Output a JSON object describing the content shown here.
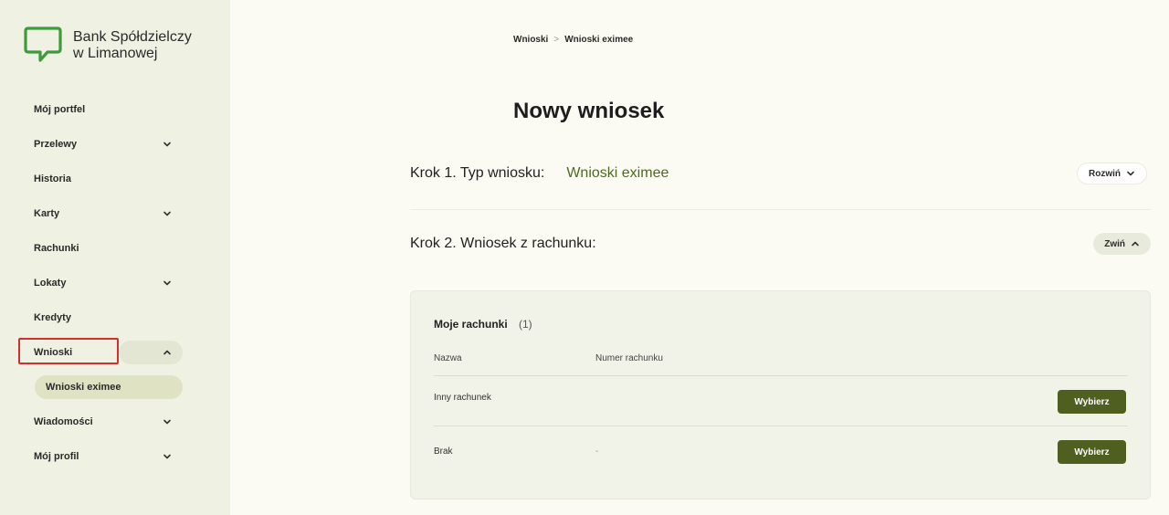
{
  "brand": {
    "line1": "Bank Spółdzielczy",
    "line2": "w Limanowej",
    "accent": "#3f9a3b"
  },
  "sidebar": {
    "items": [
      {
        "label": "Mój portfel"
      },
      {
        "label": "Przelewy"
      },
      {
        "label": "Historia"
      },
      {
        "label": "Karty"
      },
      {
        "label": "Rachunki"
      },
      {
        "label": "Lokaty"
      },
      {
        "label": "Kredyty"
      },
      {
        "label": "Wnioski"
      },
      {
        "label": "Wiadomości"
      },
      {
        "label": "Mój profil"
      }
    ],
    "sub_item": "Wnioski eximee"
  },
  "breadcrumb": {
    "items": [
      "Wnioski",
      "Wnioski eximee"
    ],
    "separator": ">"
  },
  "page": {
    "title": "Nowy wniosek"
  },
  "steps": [
    {
      "label": "Krok 1. Typ wniosku:",
      "value": "Wnioski eximee",
      "button": "Rozwiń"
    },
    {
      "label": "Krok 2. Wniosek z rachunku:",
      "value": "",
      "button": "Zwiń"
    }
  ],
  "accounts": {
    "title": "Moje rachunki",
    "count": "(1)",
    "columns": [
      "Nazwa",
      "Numer rachunku"
    ],
    "rows": [
      {
        "name": "Inny rachunek",
        "number": "",
        "button": "Wybierz"
      },
      {
        "name": "Brak",
        "number": "-",
        "button": "Wybierz"
      }
    ]
  },
  "colors": {
    "primary_button": "#4f5f20",
    "step_value": "#4e6a1f",
    "sidebar_bg": "#eff1e2",
    "active_sub": "#dfe3c4",
    "highlight": "#d42e2e"
  }
}
